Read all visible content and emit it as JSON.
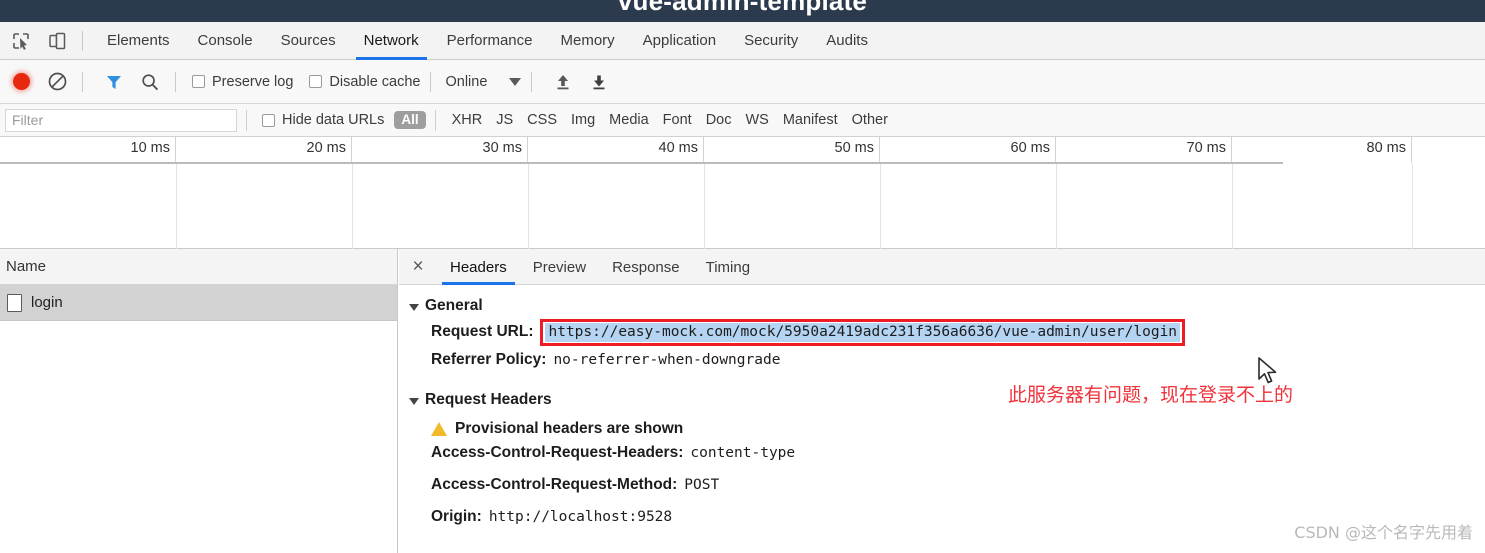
{
  "window": {
    "title": "vue-admin-template"
  },
  "devtools": {
    "icons": {
      "inspect": "inspect-element-icon",
      "device": "device-toolbar-icon"
    },
    "tabs": [
      {
        "label": "Elements",
        "active": false
      },
      {
        "label": "Console",
        "active": false
      },
      {
        "label": "Sources",
        "active": false
      },
      {
        "label": "Network",
        "active": true
      },
      {
        "label": "Performance",
        "active": false
      },
      {
        "label": "Memory",
        "active": false
      },
      {
        "label": "Application",
        "active": false
      },
      {
        "label": "Security",
        "active": false
      },
      {
        "label": "Audits",
        "active": false
      }
    ],
    "accent_color": "#1a73e8"
  },
  "toolbar": {
    "record_label": "record-button",
    "clear_label": "clear-button",
    "filter_label": "filter-button",
    "search_label": "search-button",
    "preserve_log": "Preserve log",
    "disable_cache": "Disable cache",
    "throttling": "Online",
    "import_label": "import-har-button",
    "export_label": "export-har-button"
  },
  "filterbar": {
    "placeholder": "Filter",
    "value": "",
    "hide_data_urls": "Hide data URLs",
    "types": [
      "All",
      "XHR",
      "JS",
      "CSS",
      "Img",
      "Media",
      "Font",
      "Doc",
      "WS",
      "Manifest",
      "Other"
    ],
    "active_type": "All"
  },
  "timeline": {
    "ticks": [
      "10 ms",
      "20 ms",
      "30 ms",
      "40 ms",
      "50 ms",
      "60 ms",
      "70 ms",
      "80 ms"
    ]
  },
  "requests": {
    "column_header": "Name",
    "rows": [
      {
        "name": "login",
        "selected": true
      }
    ]
  },
  "details": {
    "close_label": "×",
    "tabs": [
      {
        "label": "Headers",
        "active": true
      },
      {
        "label": "Preview",
        "active": false
      },
      {
        "label": "Response",
        "active": false
      },
      {
        "label": "Timing",
        "active": false
      }
    ],
    "general": {
      "section": "General",
      "request_url_key": "Request URL:",
      "request_url_value": "https://easy-mock.com/mock/5950a2419adc231f356a6636/vue-admin/user/login",
      "referrer_policy_key": "Referrer Policy:",
      "referrer_policy_value": "no-referrer-when-downgrade",
      "highlight_color": "#b4d4f2",
      "box_color": "#ee1c25"
    },
    "request_headers": {
      "section": "Request Headers",
      "provisional_warning": "Provisional headers are shown",
      "items": [
        {
          "key": "Access-Control-Request-Headers:",
          "value": "content-type"
        },
        {
          "key": "Access-Control-Request-Method:",
          "value": "POST"
        },
        {
          "key": "Origin:",
          "value": "http://localhost:9528"
        }
      ]
    }
  },
  "annotation": {
    "text": "此服务器有问题，现在登录不上的",
    "color": "#f0333a"
  },
  "watermark": {
    "text": "CSDN @这个名字先用着"
  }
}
